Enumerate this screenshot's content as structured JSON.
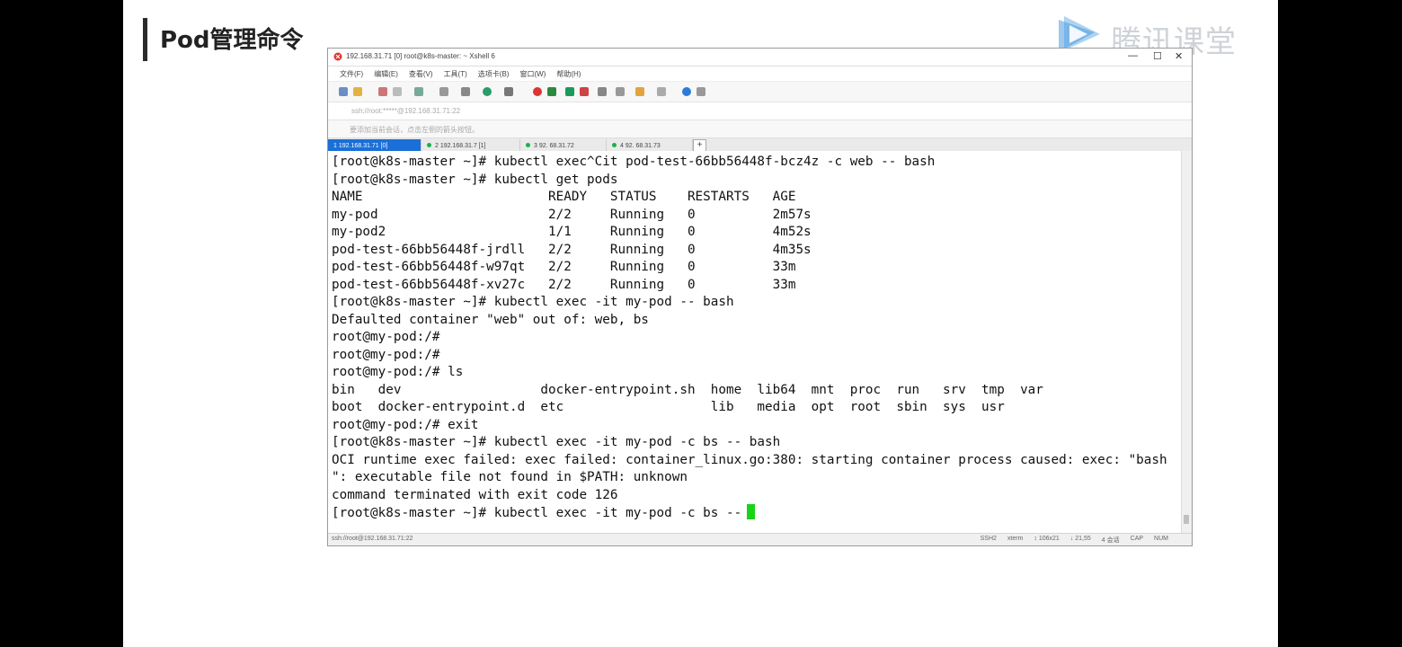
{
  "slide": {
    "title": "Pod管理命令"
  },
  "logo": {
    "text": "腾讯课堂"
  },
  "window": {
    "title": "192.168.31.71 [0]    root@k8s-master: ~    Xshell 6",
    "minimize": "—",
    "maximize": "☐",
    "close": "✕"
  },
  "menu": [
    "文件(F)",
    "编辑(E)",
    "查看(V)",
    "工具(T)",
    "选项卡(B)",
    "窗口(W)",
    "帮助(H)"
  ],
  "address": "ssh://root:*****@192.168.31.71:22",
  "hint": "要添加当前会话，点击左侧的箭头按钮。",
  "tabs": [
    {
      "label": "1 192.168.31.71 [0]"
    },
    {
      "label": "2 192.168.31.7  [1]"
    },
    {
      "label": "3  92.  68.31.72"
    },
    {
      "label": "4  92.  68.31.73"
    }
  ],
  "tab_add": "+",
  "terminal": {
    "lines": [
      "[root@k8s-master ~]# kubectl exec^Cit pod-test-66bb56448f-bcz4z -c web -- bash",
      "[root@k8s-master ~]# kubectl get pods",
      "NAME                        READY   STATUS    RESTARTS   AGE",
      "my-pod                      2/2     Running   0          2m57s",
      "my-pod2                     1/1     Running   0          4m52s",
      "pod-test-66bb56448f-jrdll   2/2     Running   0          4m35s",
      "pod-test-66bb56448f-w97qt   2/2     Running   0          33m",
      "pod-test-66bb56448f-xv27c   2/2     Running   0          33m",
      "[root@k8s-master ~]# kubectl exec -it my-pod -- bash",
      "Defaulted container \"web\" out of: web, bs",
      "root@my-pod:/#",
      "root@my-pod:/#",
      "root@my-pod:/# ls",
      "bin   dev                  docker-entrypoint.sh  home  lib64  mnt  proc  run   srv  tmp  var",
      "boot  docker-entrypoint.d  etc                   lib   media  opt  root  sbin  sys  usr",
      "root@my-pod:/# exit",
      "[root@k8s-master ~]# kubectl exec -it my-pod -c bs -- bash",
      "OCI runtime exec failed: exec failed: container_linux.go:380: starting container process caused: exec: \"bash",
      "\": executable file not found in $PATH: unknown",
      "command terminated with exit code 126"
    ],
    "prompt_line": "[root@k8s-master ~]# kubectl exec -it my-pod -c bs --"
  },
  "status": {
    "left": "ssh://root@192.168.31.71:22",
    "items": [
      "SSH2",
      "xterm",
      "↕ 106x21",
      "↓ 21,55",
      "4 会话",
      "CAP",
      "NUM"
    ]
  }
}
